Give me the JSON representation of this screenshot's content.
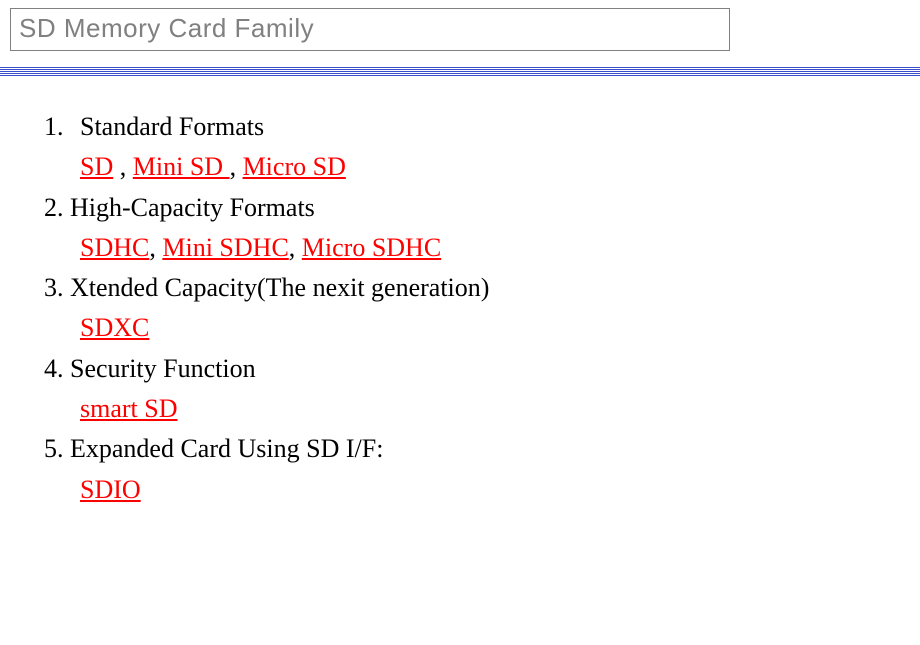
{
  "title": "SD Memory Card Family",
  "items": [
    {
      "num": "1.",
      "heading": "Standard Formats",
      "links": [
        "SD",
        "Mini SD ",
        "Micro SD"
      ],
      "sepStyle": "spaced"
    },
    {
      "num": "2.",
      "heading": "High-Capacity Formats",
      "links": [
        "SDHC",
        "Mini SDHC",
        "Micro SDHC"
      ],
      "sepStyle": "tight"
    },
    {
      "num": "3.",
      "heading": "Xtended Capacity(The nexit generation)",
      "links": [
        "SDXC"
      ],
      "sepStyle": "tight"
    },
    {
      "num": "4.",
      "heading": "Security Function",
      "links": [
        "smart SD"
      ],
      "sepStyle": "tight"
    },
    {
      "num": "5.",
      "heading": "Expanded Card Using SD I/F:",
      "links": [
        "SDIO"
      ],
      "sepStyle": "tight"
    }
  ]
}
